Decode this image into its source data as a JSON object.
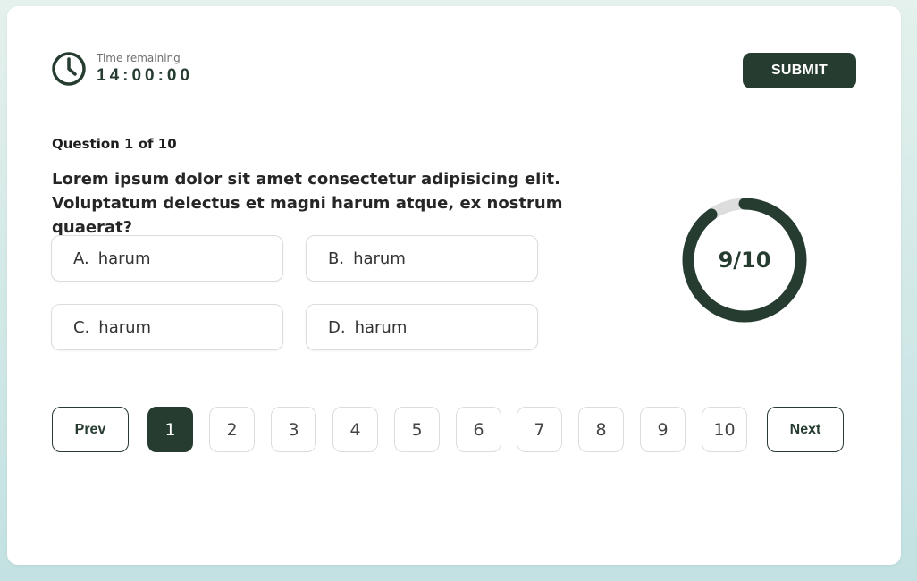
{
  "timer": {
    "label": "Time remaining",
    "value": "14:00:00",
    "icon": "clock-icon"
  },
  "submit_label": "SUBMIT",
  "question": {
    "counter": "Question 1 of 10",
    "text": "Lorem ipsum dolor sit amet consectetur adipisicing elit. Voluptatum delectus et magni harum atque, ex nostrum quaerat?"
  },
  "options": [
    {
      "letter": "A.",
      "text": "harum"
    },
    {
      "letter": "B.",
      "text": "harum"
    },
    {
      "letter": "C.",
      "text": "harum"
    },
    {
      "letter": "D.",
      "text": "harum"
    }
  ],
  "progress": {
    "label": "9/10",
    "fraction": 0.9
  },
  "pagination": {
    "prev_label": "Prev",
    "next_label": "Next",
    "pages": [
      "1",
      "2",
      "3",
      "4",
      "5",
      "6",
      "7",
      "8",
      "9",
      "10"
    ],
    "active_page": "1"
  },
  "colors": {
    "accent": "#263c30",
    "track": "#dddddd"
  }
}
